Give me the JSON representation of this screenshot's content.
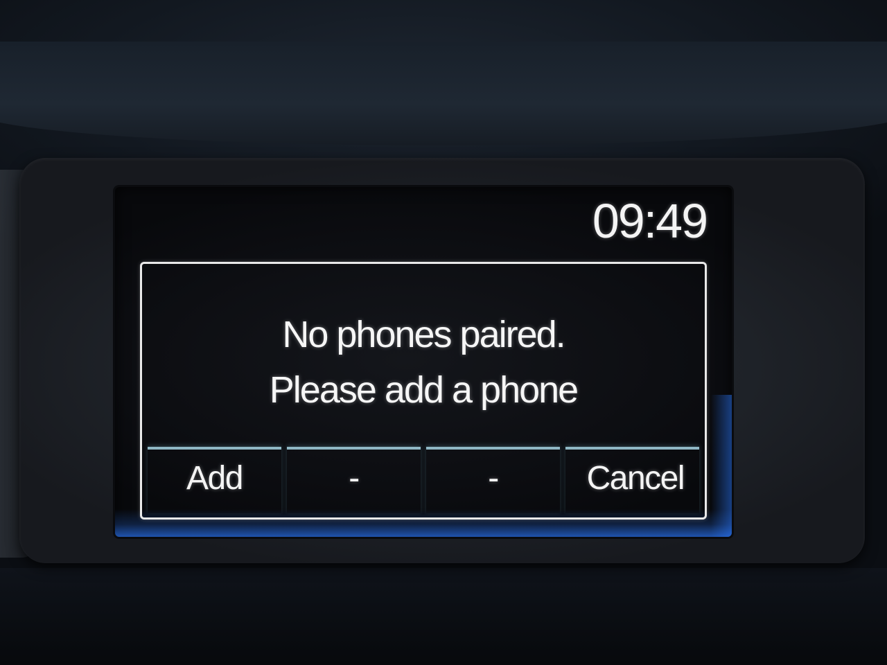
{
  "display": {
    "clock": "09:49",
    "message_line1": "No phones paired.",
    "message_line2": "Please add a phone"
  },
  "softkeys": [
    {
      "label": "Add"
    },
    {
      "label": "-"
    },
    {
      "label": "-"
    },
    {
      "label": "Cancel"
    }
  ],
  "colors": {
    "text": "#f4f4f4",
    "softkey_divider": "#8fb7c4",
    "screen_backlight": "#286ee6",
    "screen_background": "#0c0d11"
  }
}
